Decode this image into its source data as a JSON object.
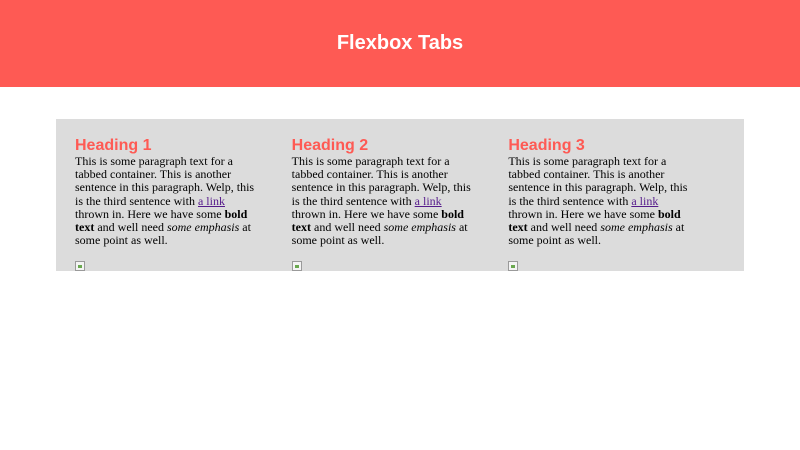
{
  "header": {
    "title": "Flexbox Tabs",
    "bg_color": "#fe5a54"
  },
  "tabs": [
    {
      "heading": "Heading 1",
      "text_1": "This is some paragraph text for a tabbed container. This is another sentence in this paragraph. Welp, this is the third sentence with ",
      "link": "a link",
      "text_2": " thrown in. Here we have some ",
      "bold": "bold text",
      "text_3": " and well need ",
      "emphasis": "some emphasis",
      "text_4": " at some point as well."
    },
    {
      "heading": "Heading 2",
      "text_1": "This is some paragraph text for a tabbed container. This is another sentence in this paragraph. Welp, this is the third sentence with ",
      "link": "a link",
      "text_2": " thrown in. Here we have some ",
      "bold": "bold text",
      "text_3": " and well need ",
      "emphasis": "some emphasis",
      "text_4": " at some point as well."
    },
    {
      "heading": "Heading 3",
      "text_1": "This is some paragraph text for a tabbed container. This is another sentence in this paragraph. Welp, this is the third sentence with ",
      "link": "a link",
      "text_2": " thrown in. Here we have some ",
      "bold": "bold text",
      "text_3": " and well need ",
      "emphasis": "some emphasis",
      "text_4": " at some point as well."
    }
  ],
  "colors": {
    "accent": "#fe5a54",
    "container_bg": "#dcdcdc",
    "link": "#551a8b"
  },
  "icons": {
    "broken_image": "broken-image-icon"
  }
}
